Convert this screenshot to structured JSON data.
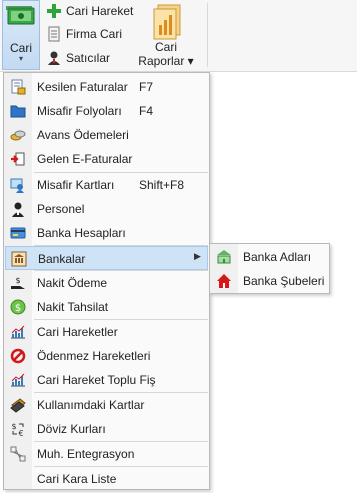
{
  "ribbon": {
    "cari_label": "Cari",
    "cari_arrow": "▾",
    "cari_hareket": "Cari Hareket",
    "firma_cari": "Firma Cari",
    "saticilar": "Satıcılar",
    "cari_raporlar_line1": "Cari",
    "cari_raporlar_line2": "Raporlar ▾"
  },
  "menu": {
    "items": [
      {
        "label": "Kesilen Faturalar",
        "shortcut": "F7",
        "icon": "invoice-lock-icon"
      },
      {
        "label": "Misafir Folyoları",
        "shortcut": "F4",
        "icon": "folder-icon"
      },
      {
        "label": "Avans Ödemeleri",
        "shortcut": "",
        "icon": "coins-icon"
      },
      {
        "label": "Gelen E-Faturalar",
        "shortcut": "",
        "icon": "inbox-arrow-icon"
      },
      {
        "label": "Misafir Kartları",
        "shortcut": "Shift+F8",
        "icon": "guest-card-icon"
      },
      {
        "label": "Personel",
        "shortcut": "",
        "icon": "person-icon"
      },
      {
        "label": "Banka Hesapları",
        "shortcut": "",
        "icon": "bank-card-icon"
      },
      {
        "label": "Bankalar",
        "shortcut": "",
        "icon": "bank-icon",
        "submenu_arrow": "▶"
      },
      {
        "label": "Nakit Ödeme",
        "shortcut": "",
        "icon": "cash-payment-icon"
      },
      {
        "label": "Nakit Tahsilat",
        "shortcut": "",
        "icon": "dollar-coin-icon"
      },
      {
        "label": "Cari Hareketler",
        "shortcut": "",
        "icon": "bar-chart-icon"
      },
      {
        "label": "Ödenmez Hareketleri",
        "shortcut": "",
        "icon": "prohibited-icon"
      },
      {
        "label": "Cari Hareket Toplu Fiş",
        "shortcut": "",
        "icon": "bar-chart-icon"
      },
      {
        "label": "Kullanımdaki Kartlar",
        "shortcut": "",
        "icon": "card-stack-icon"
      },
      {
        "label": "Döviz Kurları",
        "shortcut": "",
        "icon": "currency-exchange-icon"
      },
      {
        "label": "Muh. Entegrasyon",
        "shortcut": "",
        "icon": "network-icon"
      },
      {
        "label": "Cari Kara Liste",
        "shortcut": "",
        "icon": ""
      }
    ]
  },
  "submenu": {
    "items": [
      {
        "label": "Banka Adları",
        "icon": "bank-building-icon"
      },
      {
        "label": "Banka Şubeleri",
        "icon": "home-icon"
      }
    ]
  }
}
